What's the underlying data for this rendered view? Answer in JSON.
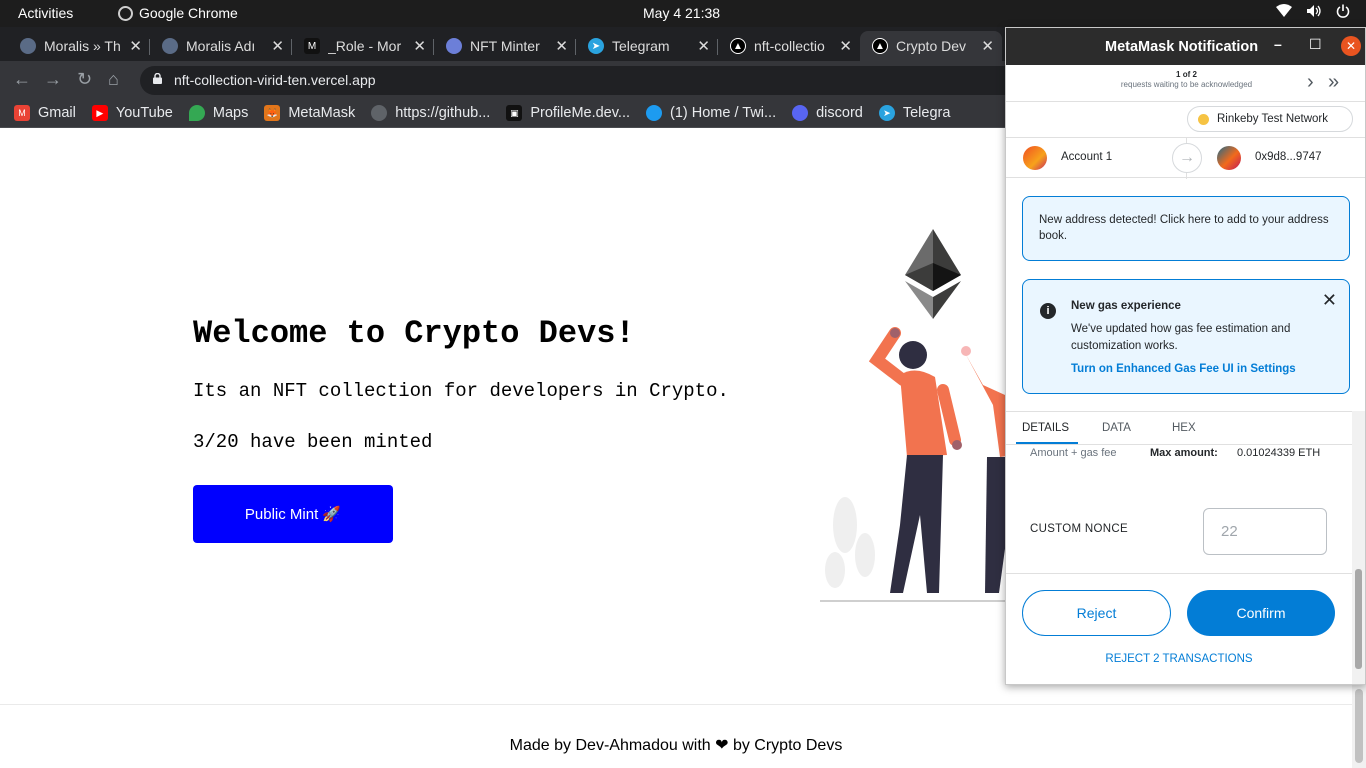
{
  "os": {
    "activities": "Activities",
    "app_name": "Google Chrome",
    "clock": "May 4  21:38"
  },
  "tabs": [
    {
      "title": "Moralis » Th",
      "favicon_color": "#5a6b86"
    },
    {
      "title": "Moralis Adı",
      "favicon_color": "#5a6b86"
    },
    {
      "title": "_Role - Mor",
      "favicon_color": "#111111"
    },
    {
      "title": "NFT Minter",
      "favicon_color": "#6c7fd8"
    },
    {
      "title": "Telegram",
      "favicon_color": "#2aa3df"
    },
    {
      "title": "nft-collectio",
      "favicon_color": "#000000"
    },
    {
      "title": "Crypto Dev",
      "favicon_color": "#000000"
    }
  ],
  "address_bar": {
    "url": "nft-collection-virid-ten.vercel.app"
  },
  "bookmarks": [
    {
      "label": "Gmail",
      "icon": "gmail-icon",
      "color": "#ea4335"
    },
    {
      "label": "YouTube",
      "icon": "youtube-icon",
      "color": "#ff0000"
    },
    {
      "label": "Maps",
      "icon": "maps-icon",
      "color": "#34a853"
    },
    {
      "label": "MetaMask",
      "icon": "metamask-icon",
      "color": "#e2761b"
    },
    {
      "label": "https://github...",
      "icon": "globe-icon",
      "color": "#5f6368"
    },
    {
      "label": "ProfileMe.dev...",
      "icon": "profileme-icon",
      "color": "#111111"
    },
    {
      "label": "(1) Home / Twi...",
      "icon": "twitter-icon",
      "color": "#1d9bf0"
    },
    {
      "label": "discord",
      "icon": "discord-icon",
      "color": "#5865f2"
    },
    {
      "label": "Telegra",
      "icon": "telegram-icon",
      "color": "#2aa3df"
    }
  ],
  "page": {
    "title": "Welcome to Crypto Devs!",
    "description": "Its an NFT collection for developers in Crypto.",
    "minted_status": "3/20 have been minted",
    "mint_button": "Public Mint 🚀",
    "footer": "Made by Dev-Ahmadou with ❤ by Crypto Devs",
    "accent": "#0000ff"
  },
  "metamask": {
    "window_title": "MetaMask Notification",
    "queue_position": "1 of 2",
    "queue_text": "requests waiting to be acknowledged",
    "network": "Rinkeby Test Network",
    "from_account": "Account 1",
    "to_account": "0x9d8...9747",
    "new_address_notice": "New address detected! Click here to add to your address book.",
    "gas_title": "New gas experience",
    "gas_body": "We've updated how gas fee estimation and customization works.",
    "gas_link": "Turn on Enhanced Gas Fee UI in Settings",
    "tabs": [
      "DETAILS",
      "DATA",
      "HEX"
    ],
    "amount_label": "Amount + gas fee",
    "max_amount_label": "Max amount:",
    "max_amount_value": "0.01024339 ETH",
    "custom_nonce_label": "CUSTOM NONCE",
    "custom_nonce_placeholder": "22",
    "reject_button": "Reject",
    "confirm_button": "Confirm",
    "reject_all": "REJECT 2 TRANSACTIONS",
    "accent": "#037dd6"
  }
}
